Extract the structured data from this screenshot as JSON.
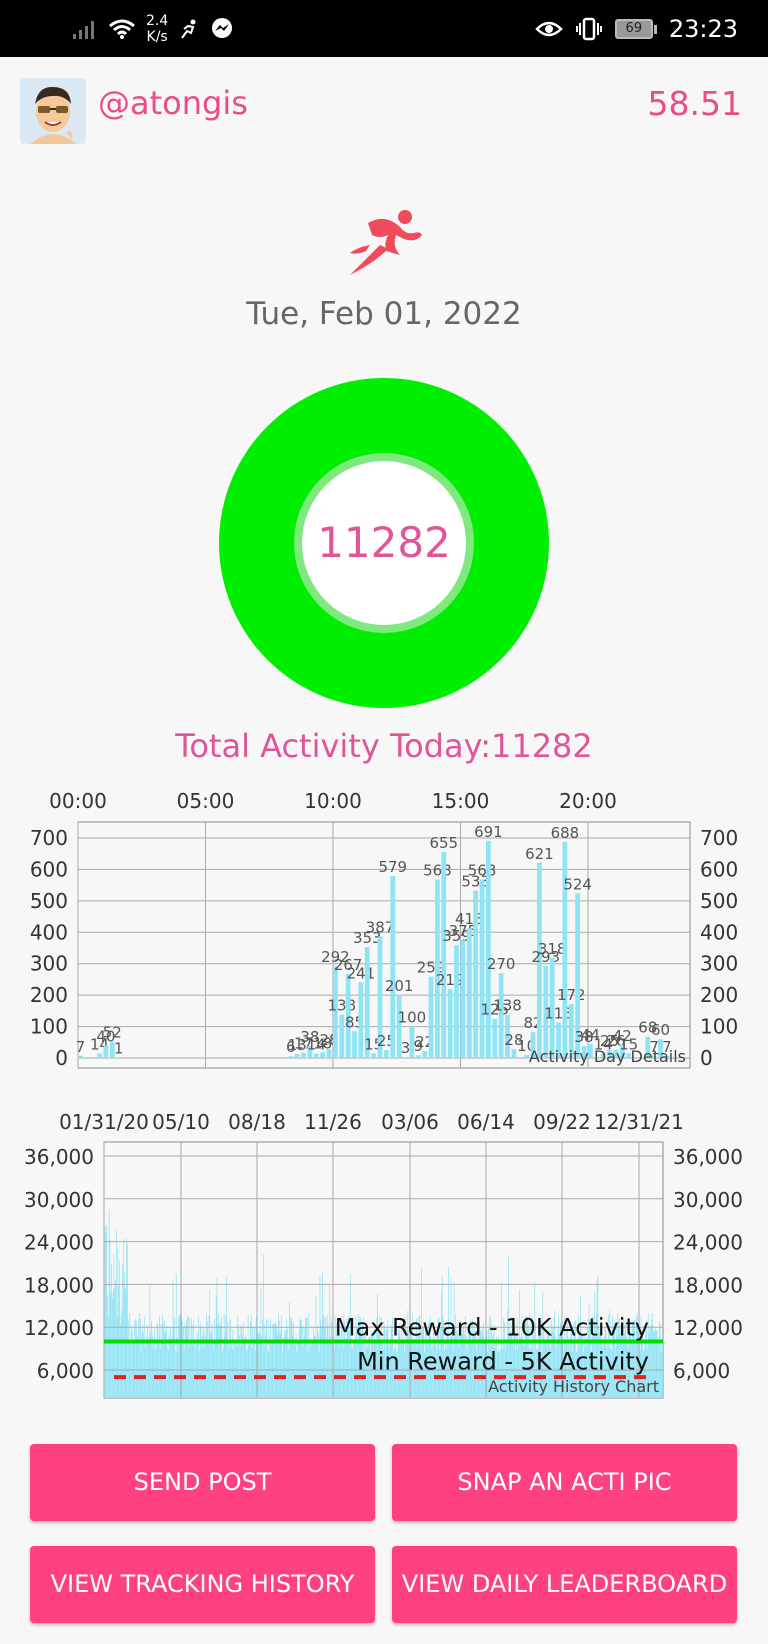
{
  "status_bar": {
    "net_speed_value": "2.4",
    "net_speed_unit": "K/s",
    "battery": "69",
    "time": "23:23"
  },
  "header": {
    "username": "@atongis",
    "balance": "58.51"
  },
  "date": "Tue, Feb 01, 2022",
  "ring": {
    "value": "11282"
  },
  "total_activity": "Total Activity Today:11282",
  "buttons": {
    "send_post": "SEND POST",
    "snap_pic": "SNAP AN ACTI PIC",
    "tracking_history": "VIEW TRACKING HISTORY",
    "daily_leaderboard": "VIEW DAILY LEADERBOARD"
  },
  "colors": {
    "accent": "#ff4081",
    "ring": "#00ee00",
    "bar": "#8ee3f5"
  },
  "chart_data": [
    {
      "type": "bar",
      "title": "Activity Day Details",
      "x_tick_labels": [
        "00:00",
        "05:00",
        "10:00",
        "15:00",
        "20:00"
      ],
      "x_unit": "hour",
      "ylim": [
        0,
        700
      ],
      "y_tick_labels": [
        "0",
        "100",
        "200",
        "300",
        "400",
        "500",
        "600",
        "700"
      ],
      "bars": [
        {
          "x": 0.0,
          "v": 7,
          "label": "7"
        },
        {
          "x": 0.75,
          "v": 14,
          "label": "14"
        },
        {
          "x": 1.0,
          "v": 40,
          "label": "40"
        },
        {
          "x": 1.25,
          "v": 52,
          "label": "52"
        },
        {
          "x": 1.5,
          "v": 1,
          "label": "1"
        },
        {
          "x": 8.25,
          "v": 6,
          "label": "6"
        },
        {
          "x": 8.5,
          "v": 13,
          "label": "13"
        },
        {
          "x": 8.75,
          "v": 17,
          "label": "17"
        },
        {
          "x": 9.0,
          "v": 38,
          "label": "38"
        },
        {
          "x": 9.25,
          "v": 14,
          "label": "14"
        },
        {
          "x": 9.5,
          "v": 18,
          "label": "18"
        },
        {
          "x": 9.75,
          "v": 28,
          "label": "28"
        },
        {
          "x": 10.0,
          "v": 292,
          "label": "292"
        },
        {
          "x": 10.25,
          "v": 138,
          "label": "138"
        },
        {
          "x": 10.5,
          "v": 267,
          "label": "267"
        },
        {
          "x": 10.75,
          "v": 85,
          "label": "85"
        },
        {
          "x": 11.0,
          "v": 241,
          "label": "241"
        },
        {
          "x": 11.25,
          "v": 353,
          "label": "353"
        },
        {
          "x": 11.5,
          "v": 15,
          "label": "15"
        },
        {
          "x": 11.75,
          "v": 387,
          "label": "387"
        },
        {
          "x": 12.0,
          "v": 25,
          "label": "25"
        },
        {
          "x": 12.25,
          "v": 579,
          "label": "579"
        },
        {
          "x": 12.5,
          "v": 201,
          "label": "201"
        },
        {
          "x": 12.75,
          "v": 3,
          "label": "3"
        },
        {
          "x": 13.0,
          "v": 100,
          "label": "100"
        },
        {
          "x": 13.25,
          "v": 9,
          "label": "9"
        },
        {
          "x": 13.5,
          "v": 22,
          "label": "22"
        },
        {
          "x": 13.75,
          "v": 259,
          "label": "259"
        },
        {
          "x": 14.0,
          "v": 568,
          "label": "568"
        },
        {
          "x": 14.25,
          "v": 655,
          "label": "655"
        },
        {
          "x": 14.5,
          "v": 219,
          "label": "219"
        },
        {
          "x": 14.75,
          "v": 359,
          "label": "359"
        },
        {
          "x": 15.0,
          "v": 375,
          "label": "375"
        },
        {
          "x": 15.25,
          "v": 413,
          "label": "413"
        },
        {
          "x": 15.5,
          "v": 533,
          "label": "533"
        },
        {
          "x": 15.75,
          "v": 568,
          "label": "568"
        },
        {
          "x": 16.0,
          "v": 691,
          "label": "691"
        },
        {
          "x": 16.25,
          "v": 125,
          "label": "125"
        },
        {
          "x": 16.5,
          "v": 270,
          "label": "270"
        },
        {
          "x": 16.75,
          "v": 138,
          "label": "138"
        },
        {
          "x": 17.0,
          "v": 28,
          "label": "28"
        },
        {
          "x": 17.5,
          "v": 10,
          "label": "10"
        },
        {
          "x": 17.75,
          "v": 82,
          "label": "82"
        },
        {
          "x": 18.0,
          "v": 621,
          "label": "621"
        },
        {
          "x": 18.25,
          "v": 293,
          "label": "293"
        },
        {
          "x": 18.5,
          "v": 318,
          "label": "318"
        },
        {
          "x": 18.75,
          "v": 113,
          "label": "113"
        },
        {
          "x": 19.0,
          "v": 688,
          "label": "688"
        },
        {
          "x": 19.25,
          "v": 172,
          "label": "172"
        },
        {
          "x": 19.5,
          "v": 524,
          "label": "524"
        },
        {
          "x": 19.75,
          "v": 38,
          "label": "38"
        },
        {
          "x": 20.0,
          "v": 44,
          "label": "44"
        },
        {
          "x": 20.5,
          "v": 14,
          "label": "14"
        },
        {
          "x": 20.75,
          "v": 25,
          "label": "25"
        },
        {
          "x": 21.0,
          "v": 26,
          "label": "26"
        },
        {
          "x": 21.25,
          "v": 42,
          "label": "42"
        },
        {
          "x": 21.5,
          "v": 15,
          "label": "15"
        },
        {
          "x": 22.25,
          "v": 68,
          "label": "68"
        },
        {
          "x": 22.5,
          "v": 7,
          "label": "7"
        },
        {
          "x": 22.75,
          "v": 60,
          "label": "60"
        },
        {
          "x": 23.0,
          "v": 7,
          "label": "7"
        }
      ]
    },
    {
      "type": "bar",
      "title": "Activity History Chart",
      "x_tick_labels": [
        "01/31/20",
        "05/10",
        "08/18",
        "11/26",
        "03/06",
        "06/14",
        "09/22",
        "12/31/21"
      ],
      "ylim": [
        0,
        36000
      ],
      "y_tick_labels": [
        "6,000",
        "12,000",
        "18,000",
        "24,000",
        "30,000",
        "36,000"
      ],
      "reference_lines": [
        {
          "label": "Max Reward - 10K Activity",
          "value": 10000,
          "style": "solid",
          "color": "#00dd00"
        },
        {
          "label": "Min Reward - 5K Activity",
          "value": 5000,
          "style": "dashed",
          "color": "#dd2222"
        }
      ],
      "trend": "dense daily series, ~8,000-15,000 typical with peaks near 33,000 at start"
    }
  ]
}
